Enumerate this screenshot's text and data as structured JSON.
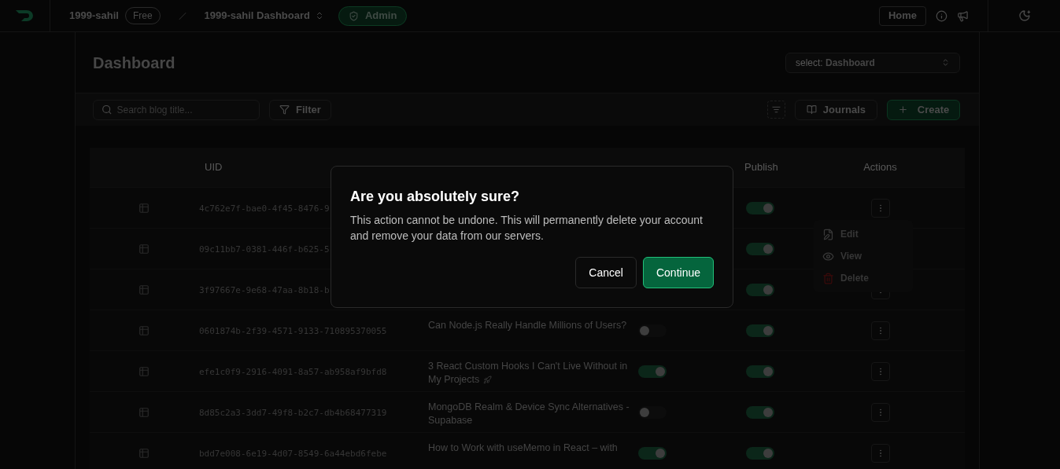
{
  "header": {
    "workspace": "1999-sahil",
    "plan": "Free",
    "project": "1999-sahil Dashboard",
    "role": "Admin",
    "home": "Home"
  },
  "page": {
    "title": "Dashboard",
    "select_label": "select:",
    "select_value": "Dashboard"
  },
  "toolbar": {
    "search_placeholder": "Search blog title...",
    "filter": "Filter",
    "journals": "Journals",
    "create": "Create"
  },
  "table": {
    "uid_heading": "UID",
    "publish_heading": "Publish",
    "actions_heading": "Actions",
    "rows": [
      {
        "uid": "4c762e7f-bae0-4f45-8476-9",
        "published": true,
        "menu_open": true
      },
      {
        "uid": "09c11bb7-0381-446f-b625-5",
        "published": true
      },
      {
        "uid": "3f97667e-9e68-47aa-8b18-b",
        "published": true
      },
      {
        "uid": "0601874b-2f39-4571-9133-710895370055",
        "title": "Can Node.js Really Handle Millions of Users?",
        "premium": false,
        "published": true
      },
      {
        "uid": "efe1c0f9-2916-4091-8a57-ab958af9bfd8",
        "title": "3 React Custom Hooks I Can't Live Without in My Projects",
        "rocket": true,
        "premium": true,
        "published": true
      },
      {
        "uid": "8d85c2a3-3dd7-49f8-b2c7-db4b68477319",
        "title": "MongoDB Realm & Device Sync Alternatives - Supabase",
        "premium": false,
        "published": true
      },
      {
        "uid": "bdd7e008-6e19-4d07-8549-6a44ebd6febe",
        "title": "How to Work with useMemo in React – with",
        "premium": true,
        "published": true
      }
    ]
  },
  "row_menu": [
    {
      "label": "Edit",
      "kind": "edit"
    },
    {
      "label": "View",
      "kind": "view"
    },
    {
      "label": "Delete",
      "kind": "delete"
    }
  ],
  "dialog": {
    "title": "Are you absolutely sure?",
    "description": "This action cannot be undone. This will permanently delete your account and remove your data from our servers.",
    "cancel": "Cancel",
    "confirm": "Continue"
  }
}
